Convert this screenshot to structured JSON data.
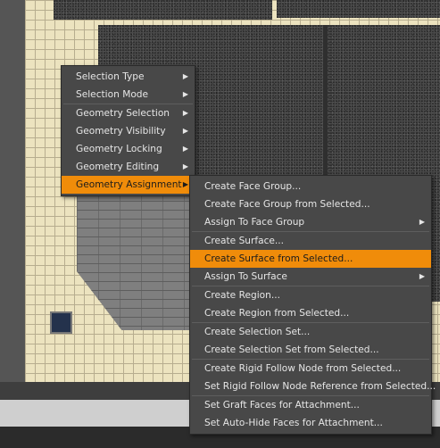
{
  "colors": {
    "menu_bg": "#484848",
    "highlight": "#f08c0a",
    "menu_text": "#e6e6e6"
  },
  "main_menu": {
    "items": [
      {
        "label": "Selection Type"
      },
      {
        "label": "Selection Mode"
      },
      {
        "label": "Geometry Selection"
      },
      {
        "label": "Geometry Visibility"
      },
      {
        "label": "Geometry Locking"
      },
      {
        "label": "Geometry Editing"
      },
      {
        "label": "Geometry Assignment"
      }
    ]
  },
  "sub_menu": {
    "items": [
      {
        "label": "Create Face Group..."
      },
      {
        "label": "Create Face Group from Selected..."
      },
      {
        "label": "Assign To Face Group"
      },
      {
        "label": "Create Surface..."
      },
      {
        "label": "Create Surface from Selected..."
      },
      {
        "label": "Assign To Surface"
      },
      {
        "label": "Create Region..."
      },
      {
        "label": "Create Region from Selected..."
      },
      {
        "label": "Create Selection Set..."
      },
      {
        "label": "Create Selection Set from Selected..."
      },
      {
        "label": "Create Rigid Follow Node from Selected..."
      },
      {
        "label": "Set Rigid Follow Node Reference from Selected..."
      },
      {
        "label": "Set Graft Faces for Attachment..."
      },
      {
        "label": "Set Auto-Hide Faces for Attachment..."
      }
    ]
  }
}
